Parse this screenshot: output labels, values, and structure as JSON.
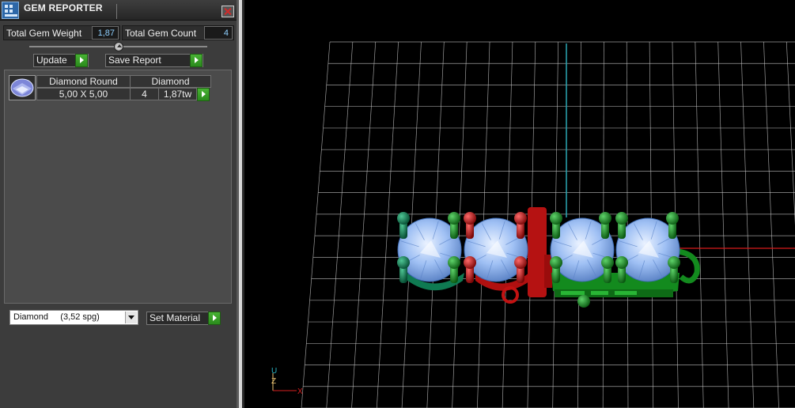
{
  "window": {
    "title": "GEM REPORTER"
  },
  "summary": {
    "weight_label": "Total Gem Weight",
    "weight_value": "1,87",
    "count_label": "Total Gem Count",
    "count_value": "4"
  },
  "buttons": {
    "update": "Update",
    "save_report": "Save Report",
    "set_material": "Set Material"
  },
  "gem_list": [
    {
      "name": "Diamond Round",
      "material": "Diamond",
      "size": "5,00 X 5,00",
      "count": "4",
      "weight": "1,87tw"
    }
  ],
  "material_select": {
    "selected": "Diamond     (3,52 spg)"
  },
  "viewport": {
    "axis_labels": {
      "u": "U",
      "z": "Z",
      "x": "X"
    },
    "colors": {
      "grid": "#cfcfcf",
      "x_axis": "#d81a1a",
      "y_axis": "#2aa7b4",
      "metal_red": "#c21212",
      "metal_green": "#138a1e",
      "metal_teal": "#0f7a52",
      "gem_blue": "#8fb6f0"
    }
  }
}
